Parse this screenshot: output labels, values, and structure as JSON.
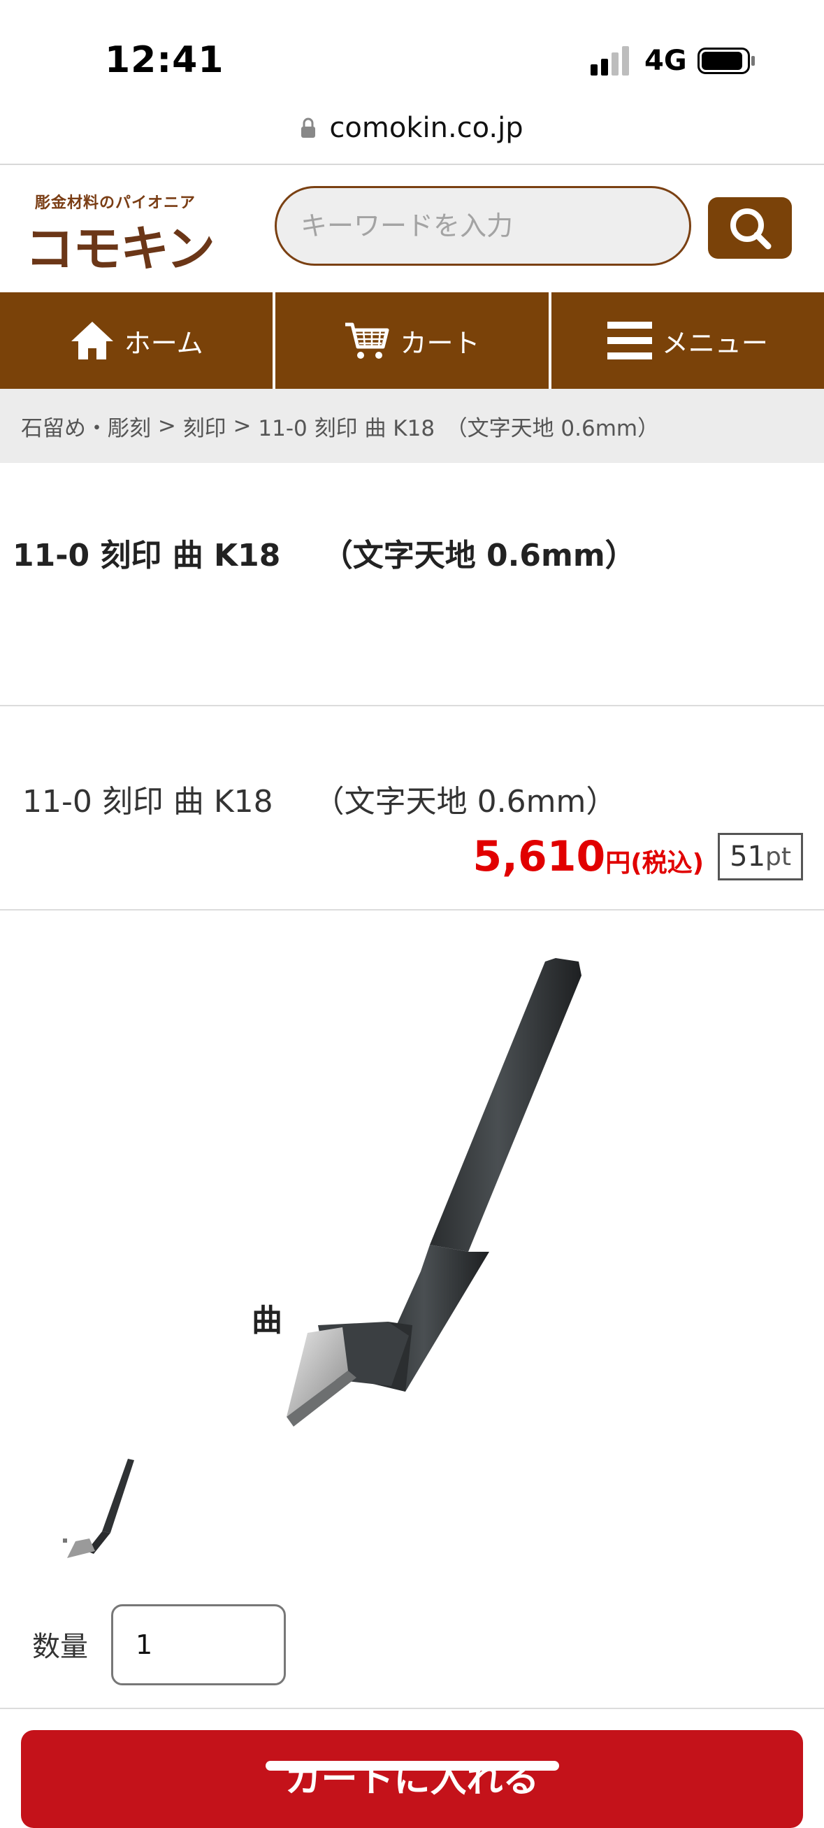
{
  "status_bar": {
    "time": "12:41",
    "network": "4G"
  },
  "browser": {
    "url": "comokin.co.jp"
  },
  "header": {
    "logo_tagline": "彫金材料のパイオニア",
    "logo_text": "コモキン",
    "search_placeholder": "キーワードを入力"
  },
  "nav": {
    "items": [
      {
        "label": "ホーム",
        "icon": "home-icon"
      },
      {
        "label": "カート",
        "icon": "cart-icon"
      },
      {
        "label": "メニュー",
        "icon": "menu-icon"
      }
    ]
  },
  "breadcrumb": {
    "items": [
      "石留め・彫刻",
      "刻印",
      "11-0 刻印 曲 K18　（文字天地 0.6mm）"
    ],
    "separators": [
      " > ",
      " > "
    ],
    "first_sep": "・"
  },
  "product": {
    "title": "11-0 刻印 曲 K18　 （文字天地 0.6mm）",
    "name": "11-0 刻印 曲 K18　 （文字天地 0.6mm）",
    "price": "5,610",
    "price_unit": "円(税込)",
    "points": "51",
    "points_unit": "pt",
    "image_label": "曲"
  },
  "quantity": {
    "label": "数量",
    "value": "1"
  },
  "cart_button": {
    "label": "カートに入れる"
  },
  "colors": {
    "brand": "#7a4209",
    "price": "#e10000",
    "cart": "#c4121a"
  }
}
